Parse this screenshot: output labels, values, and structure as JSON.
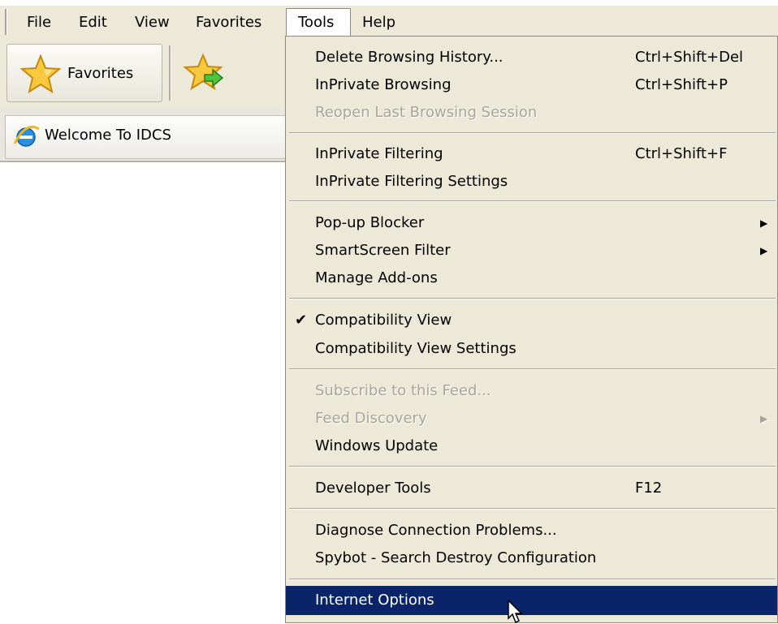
{
  "menubar": {
    "items": [
      {
        "label": "File"
      },
      {
        "label": "Edit"
      },
      {
        "label": "View"
      },
      {
        "label": "Favorites"
      },
      {
        "label": "Tools"
      },
      {
        "label": "Help"
      }
    ]
  },
  "favorites_bar": {
    "favorites_label": "Favorites",
    "favorites_icon": "star-icon",
    "add_icon": "add-to-favorites-bar-icon"
  },
  "tabs": [
    {
      "label": "Welcome To IDCS",
      "icon": "ie-icon"
    }
  ],
  "tools_menu": {
    "items": [
      {
        "label": "Delete Browsing History...",
        "shortcut": "Ctrl+Shift+Del"
      },
      {
        "label": "InPrivate Browsing",
        "shortcut": "Ctrl+Shift+P"
      },
      {
        "label": "Reopen Last Browsing Session",
        "disabled": true
      },
      {
        "label": "InPrivate Filtering",
        "shortcut": "Ctrl+Shift+F"
      },
      {
        "label": "InPrivate Filtering Settings"
      },
      {
        "label": "Pop-up Blocker",
        "submenu": true
      },
      {
        "label": "SmartScreen Filter",
        "submenu": true
      },
      {
        "label": "Manage Add-ons"
      },
      {
        "label": "Compatibility View",
        "checked": true
      },
      {
        "label": "Compatibility View Settings"
      },
      {
        "label": "Subscribe to this Feed...",
        "disabled": true
      },
      {
        "label": "Feed Discovery",
        "disabled": true,
        "submenu": true
      },
      {
        "label": "Windows Update"
      },
      {
        "label": "Developer Tools",
        "shortcut": "F12"
      },
      {
        "label": "Diagnose Connection Problems..."
      },
      {
        "label": "Spybot - Search  Destroy Configuration"
      },
      {
        "label": "Internet Options",
        "highlighted": true
      }
    ]
  },
  "colors": {
    "menu_bg": "#ece9d8",
    "highlight": "#0a246a",
    "disabled_text": "#a7a599"
  }
}
